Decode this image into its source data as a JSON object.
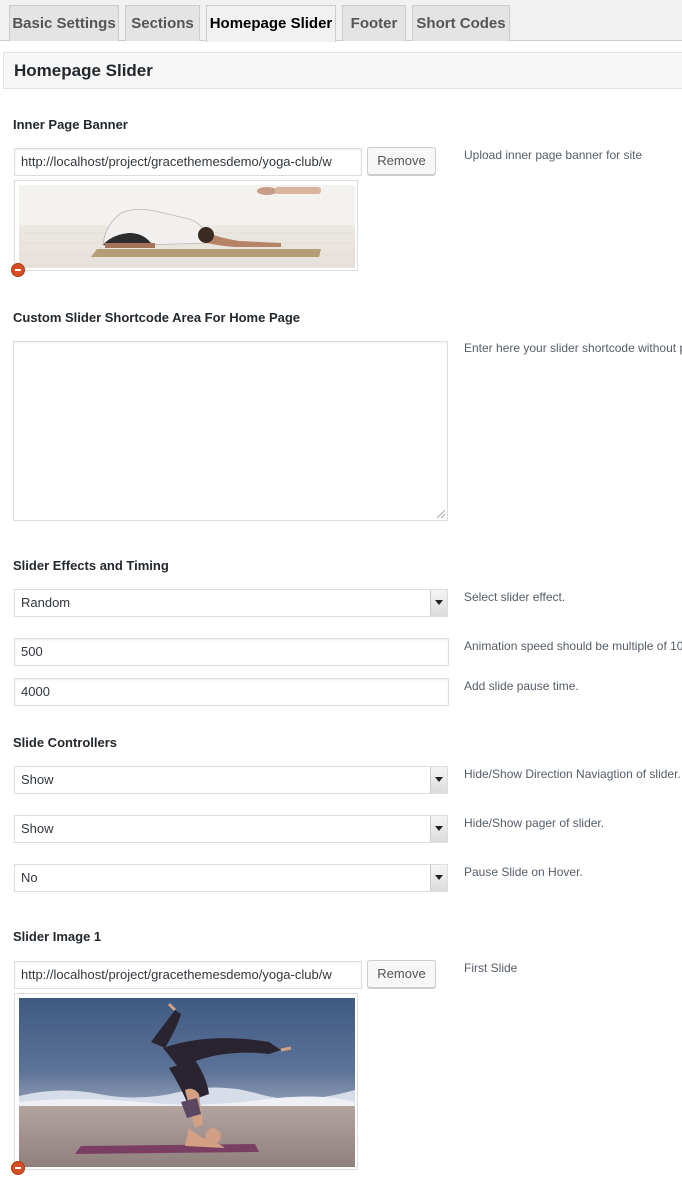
{
  "tabs": [
    {
      "label": "Basic Settings"
    },
    {
      "label": "Sections"
    },
    {
      "label": "Homepage Slider"
    },
    {
      "label": "Footer"
    },
    {
      "label": "Short Codes"
    }
  ],
  "section_title": "Homepage Slider",
  "inner_banner": {
    "heading": "Inner Page Banner",
    "url": "http://localhost/project/gracethemesdemo/yoga-club/w",
    "remove_label": "Remove",
    "description": "Upload inner page banner for site"
  },
  "shortcode": {
    "heading": "Custom Slider Shortcode Area For Home Page",
    "description": "Enter here your slider shortcode without p"
  },
  "effects": {
    "heading": "Slider Effects and Timing",
    "effect_value": "Random",
    "effect_description": "Select slider effect.",
    "speed_value": "500",
    "speed_description": "Animation speed should be multiple of 10",
    "pause_value": "4000",
    "pause_description": "Add slide pause time."
  },
  "controllers": {
    "heading": "Slide Controllers",
    "direction_value": "Show",
    "direction_description": "Hide/Show Direction Naviagtion of slider.",
    "pager_value": "Show",
    "pager_description": "Hide/Show pager of slider.",
    "hover_value": "No",
    "hover_description": "Pause Slide on Hover."
  },
  "slide1": {
    "heading": "Slider Image 1",
    "url": "http://localhost/project/gracethemesdemo/yoga-club/w",
    "remove_label": "Remove",
    "description": "First Slide"
  },
  "colors": {
    "tab_bg": "#e4e4e4",
    "remove_icon": "#d54e21",
    "heading": "#23282d"
  }
}
